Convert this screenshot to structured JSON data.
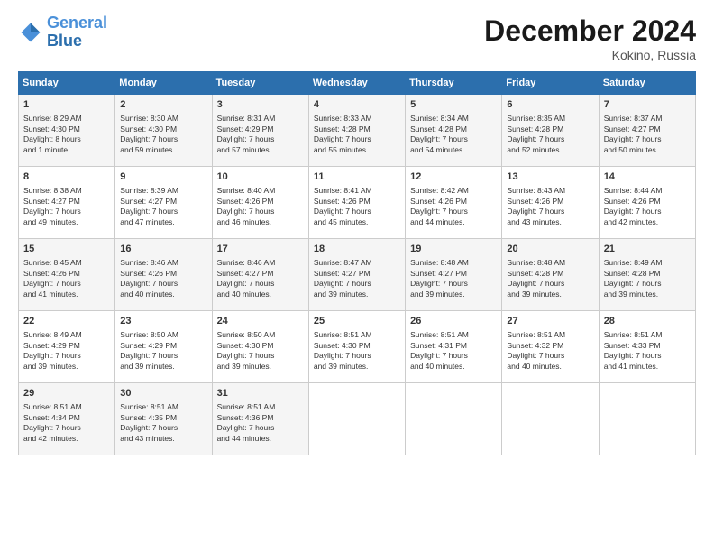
{
  "logo": {
    "line1": "General",
    "line2": "Blue"
  },
  "title": "December 2024",
  "location": "Kokino, Russia",
  "weekdays": [
    "Sunday",
    "Monday",
    "Tuesday",
    "Wednesday",
    "Thursday",
    "Friday",
    "Saturday"
  ],
  "weeks": [
    [
      {
        "day": "1",
        "info": "Sunrise: 8:29 AM\nSunset: 4:30 PM\nDaylight: 8 hours\nand 1 minute."
      },
      {
        "day": "2",
        "info": "Sunrise: 8:30 AM\nSunset: 4:30 PM\nDaylight: 7 hours\nand 59 minutes."
      },
      {
        "day": "3",
        "info": "Sunrise: 8:31 AM\nSunset: 4:29 PM\nDaylight: 7 hours\nand 57 minutes."
      },
      {
        "day": "4",
        "info": "Sunrise: 8:33 AM\nSunset: 4:28 PM\nDaylight: 7 hours\nand 55 minutes."
      },
      {
        "day": "5",
        "info": "Sunrise: 8:34 AM\nSunset: 4:28 PM\nDaylight: 7 hours\nand 54 minutes."
      },
      {
        "day": "6",
        "info": "Sunrise: 8:35 AM\nSunset: 4:28 PM\nDaylight: 7 hours\nand 52 minutes."
      },
      {
        "day": "7",
        "info": "Sunrise: 8:37 AM\nSunset: 4:27 PM\nDaylight: 7 hours\nand 50 minutes."
      }
    ],
    [
      {
        "day": "8",
        "info": "Sunrise: 8:38 AM\nSunset: 4:27 PM\nDaylight: 7 hours\nand 49 minutes."
      },
      {
        "day": "9",
        "info": "Sunrise: 8:39 AM\nSunset: 4:27 PM\nDaylight: 7 hours\nand 47 minutes."
      },
      {
        "day": "10",
        "info": "Sunrise: 8:40 AM\nSunset: 4:26 PM\nDaylight: 7 hours\nand 46 minutes."
      },
      {
        "day": "11",
        "info": "Sunrise: 8:41 AM\nSunset: 4:26 PM\nDaylight: 7 hours\nand 45 minutes."
      },
      {
        "day": "12",
        "info": "Sunrise: 8:42 AM\nSunset: 4:26 PM\nDaylight: 7 hours\nand 44 minutes."
      },
      {
        "day": "13",
        "info": "Sunrise: 8:43 AM\nSunset: 4:26 PM\nDaylight: 7 hours\nand 43 minutes."
      },
      {
        "day": "14",
        "info": "Sunrise: 8:44 AM\nSunset: 4:26 PM\nDaylight: 7 hours\nand 42 minutes."
      }
    ],
    [
      {
        "day": "15",
        "info": "Sunrise: 8:45 AM\nSunset: 4:26 PM\nDaylight: 7 hours\nand 41 minutes."
      },
      {
        "day": "16",
        "info": "Sunrise: 8:46 AM\nSunset: 4:26 PM\nDaylight: 7 hours\nand 40 minutes."
      },
      {
        "day": "17",
        "info": "Sunrise: 8:46 AM\nSunset: 4:27 PM\nDaylight: 7 hours\nand 40 minutes."
      },
      {
        "day": "18",
        "info": "Sunrise: 8:47 AM\nSunset: 4:27 PM\nDaylight: 7 hours\nand 39 minutes."
      },
      {
        "day": "19",
        "info": "Sunrise: 8:48 AM\nSunset: 4:27 PM\nDaylight: 7 hours\nand 39 minutes."
      },
      {
        "day": "20",
        "info": "Sunrise: 8:48 AM\nSunset: 4:28 PM\nDaylight: 7 hours\nand 39 minutes."
      },
      {
        "day": "21",
        "info": "Sunrise: 8:49 AM\nSunset: 4:28 PM\nDaylight: 7 hours\nand 39 minutes."
      }
    ],
    [
      {
        "day": "22",
        "info": "Sunrise: 8:49 AM\nSunset: 4:29 PM\nDaylight: 7 hours\nand 39 minutes."
      },
      {
        "day": "23",
        "info": "Sunrise: 8:50 AM\nSunset: 4:29 PM\nDaylight: 7 hours\nand 39 minutes."
      },
      {
        "day": "24",
        "info": "Sunrise: 8:50 AM\nSunset: 4:30 PM\nDaylight: 7 hours\nand 39 minutes."
      },
      {
        "day": "25",
        "info": "Sunrise: 8:51 AM\nSunset: 4:30 PM\nDaylight: 7 hours\nand 39 minutes."
      },
      {
        "day": "26",
        "info": "Sunrise: 8:51 AM\nSunset: 4:31 PM\nDaylight: 7 hours\nand 40 minutes."
      },
      {
        "day": "27",
        "info": "Sunrise: 8:51 AM\nSunset: 4:32 PM\nDaylight: 7 hours\nand 40 minutes."
      },
      {
        "day": "28",
        "info": "Sunrise: 8:51 AM\nSunset: 4:33 PM\nDaylight: 7 hours\nand 41 minutes."
      }
    ],
    [
      {
        "day": "29",
        "info": "Sunrise: 8:51 AM\nSunset: 4:34 PM\nDaylight: 7 hours\nand 42 minutes."
      },
      {
        "day": "30",
        "info": "Sunrise: 8:51 AM\nSunset: 4:35 PM\nDaylight: 7 hours\nand 43 minutes."
      },
      {
        "day": "31",
        "info": "Sunrise: 8:51 AM\nSunset: 4:36 PM\nDaylight: 7 hours\nand 44 minutes."
      },
      {
        "day": "",
        "info": ""
      },
      {
        "day": "",
        "info": ""
      },
      {
        "day": "",
        "info": ""
      },
      {
        "day": "",
        "info": ""
      }
    ]
  ]
}
